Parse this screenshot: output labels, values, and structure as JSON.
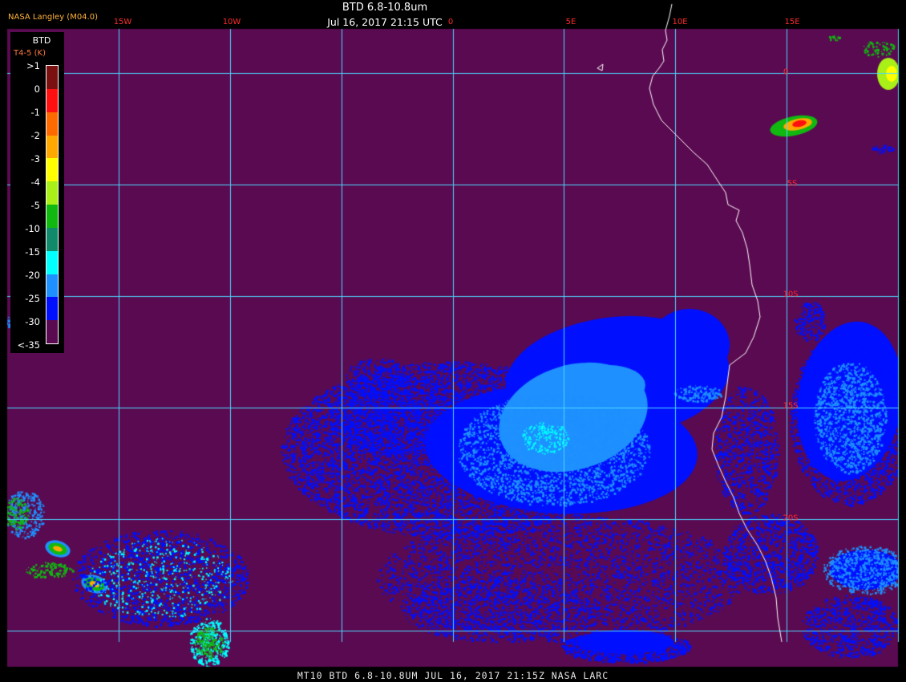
{
  "header": {
    "title": "BTD 6.8-10.8um",
    "subtitle": "Jul 16, 2017 21:15 UTC",
    "source": "NASA Langley (M04.0)"
  },
  "footer": "MT10  BTD 6.8-10.8UM  JUL 16, 2017 21:15Z  NASA LARC",
  "grid": {
    "longitude_labels": [
      "15W",
      "10W",
      "0",
      "5E",
      "10E",
      "15E"
    ],
    "latitude_labels": [
      "0",
      "5S",
      "10S",
      "15S",
      "20S"
    ]
  },
  "legend": {
    "title": "BTD",
    "units": "T4-5 (K)",
    "ticks": [
      ">1",
      "0",
      "-1",
      "-2",
      "-3",
      "-4",
      "-5",
      "-10",
      "-15",
      "-20",
      "-25",
      "-30",
      "<-35"
    ],
    "colors": [
      "#7a1010",
      "#ff1010",
      "#ff6a00",
      "#ffa800",
      "#ffff00",
      "#a8f018",
      "#10b810",
      "#108a6a",
      "#00ffff",
      "#1e90ff",
      "#0010ff",
      "#5a0a50"
    ]
  },
  "colors": {
    "background": "#5a0a50",
    "grid_line": "#4ad8ff",
    "coastline": "#ffffff",
    "label_red": "#ff2a2a"
  }
}
